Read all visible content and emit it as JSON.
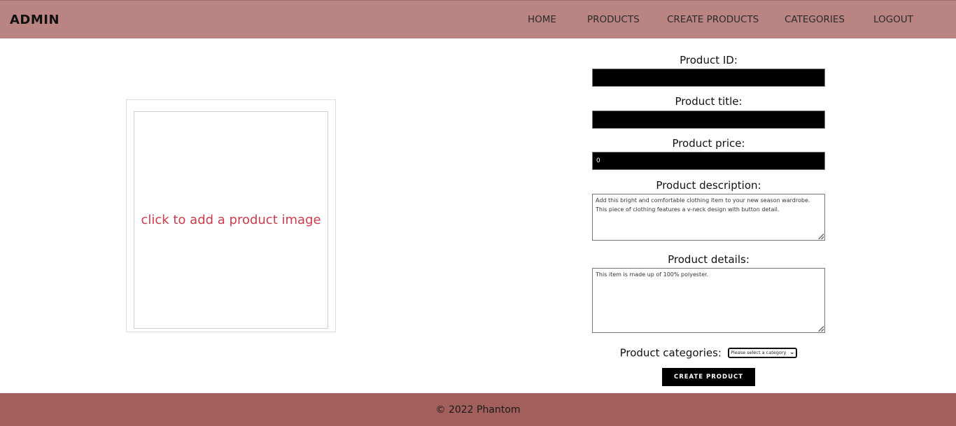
{
  "header": {
    "brand": "ADMIN",
    "nav": [
      {
        "label": "HOME"
      },
      {
        "label": "PRODUCTS"
      },
      {
        "label": "CREATE PRODUCTS"
      },
      {
        "label": "CATEGORIES"
      },
      {
        "label": "LOGOUT"
      }
    ]
  },
  "image_upload": {
    "prompt": "click to add a product image"
  },
  "form": {
    "product_id": {
      "label": "Product ID:",
      "value": ""
    },
    "product_title": {
      "label": "Product title:",
      "value": ""
    },
    "product_price": {
      "label": "Product price:",
      "value": "0"
    },
    "product_description": {
      "label": "Product description:",
      "value": "Add this bright and comfortable clothing item to your new season wardrobe. This piece of clothing features a v-neck design with button detail."
    },
    "product_details": {
      "label": "Product details:",
      "value": "This item is made up of 100% polyester."
    },
    "categories": {
      "label": "Product categories:",
      "selected": "Please select a category"
    },
    "submit_label": "CREATE PRODUCT"
  },
  "footer": {
    "text": "© 2022 Phantom"
  },
  "colors": {
    "navbar": "#b98481",
    "footer": "#a35f5c",
    "image_prompt": "#d03a4a"
  }
}
